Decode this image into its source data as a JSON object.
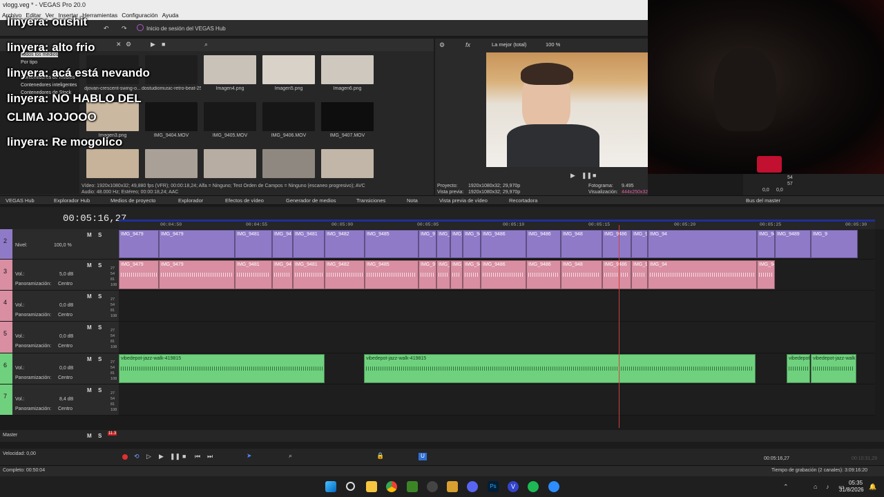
{
  "window": {
    "title": "vlogg.veg * - VEGAS Pro 20.0"
  },
  "menu": [
    "Archivo",
    "Editar",
    "Ver",
    "Insertar",
    "Herramientas",
    "Configuración",
    "Ayuda"
  ],
  "hub": {
    "label": "Inicio de sesión del VEGAS Hub"
  },
  "media": {
    "tree": [
      "Todos los medios",
      "Por tipo",
      "Contenedores de medios",
      "Contenedores inteligentes",
      "Contenedores de Stock"
    ],
    "items": [
      {
        "caption": "djovan-crescent-swing-o...",
        "color": "#1e1e1e"
      },
      {
        "caption": "dostudiomusic-retro-beat-255330.mp3",
        "color": "#1e1e1e"
      },
      {
        "caption": "Imagen4.png",
        "color": "#c9c2b8"
      },
      {
        "caption": "Imagen5.png",
        "color": "#d8d2c8"
      },
      {
        "caption": "Imagen6.png",
        "color": "#cfc8bf"
      },
      {
        "caption": "Imagen3.png",
        "color": "#cbb8a0"
      },
      {
        "caption": "IMG_9404.MOV",
        "color": "#141414"
      },
      {
        "caption": "IMG_9405.MOV",
        "color": "#181818"
      },
      {
        "caption": "IMG_9406.MOV",
        "color": "#161616"
      },
      {
        "caption": "IMG_9407.MOV",
        "color": "#0e0e0e"
      },
      {
        "caption": "",
        "color": "#c7b29a"
      },
      {
        "caption": "",
        "color": "#a9a198"
      },
      {
        "caption": "",
        "color": "#b7ada2"
      },
      {
        "caption": "",
        "color": "#8f8880"
      },
      {
        "caption": "",
        "color": "#c1b6a8"
      }
    ],
    "info1": "Vídeo: 1920x1080x32; 49,880 fps (VFR); 00:00:18,24; Alfa = Ninguno; Test Orden de Campos = Ninguno (escaneo progresivo); AVC",
    "info2": "Audio: 48.000 Hz; Estéreo; 00:00:18,24; AAC"
  },
  "preview": {
    "quality": "La mejor (total)",
    "zoom": "100 %",
    "proyecto_label": "Proyecto:",
    "proyecto": "1920x1080x32; 29,970p",
    "vista_label": "Vista previa:",
    "vista": "1920x1080x32; 29,970p",
    "fotograma_label": "Fotograma:",
    "fotograma": "9.495",
    "visual_label": "Visualización:",
    "visual": "444x250x32"
  },
  "bus": {
    "label": "Bus del master",
    "vals": [
      "54",
      "57",
      "0,0",
      "0,0"
    ]
  },
  "tabs": [
    "VEGAS Hub",
    "Explorador Hub",
    "Medios de proyecto",
    "Explorador",
    "Efectos de vídeo",
    "Generador de medios",
    "Transiciones",
    "Nota",
    "Vista previa de vídeo",
    "Recortadora",
    "Bus del master"
  ],
  "timeline": {
    "timecode": "00:05:16,27",
    "ruler": [
      "00:04:50",
      "00:04:55",
      "00:05:00",
      "00:05:05",
      "00:05:10",
      "00:05:15",
      "00:05:20",
      "00:05:25",
      "00:05:30"
    ],
    "tracks": [
      {
        "num": "2",
        "kind": "video",
        "labels": [
          "Nivel:",
          "100,0 %"
        ]
      },
      {
        "num": "3",
        "kind": "audio",
        "vol": "5,0 dB",
        "pan": "Centro"
      },
      {
        "num": "4",
        "kind": "audio",
        "vol": "0,0 dB",
        "pan": "Centro"
      },
      {
        "num": "5",
        "kind": "audio",
        "vol": "0,0 dB",
        "pan": "Centro"
      },
      {
        "num": "6",
        "kind": "audio",
        "vol": "0,0 dB",
        "pan": "Centro"
      },
      {
        "num": "7",
        "kind": "audio",
        "vol": "8,4 dB",
        "pan": "Centro"
      }
    ],
    "vol_label": "Vol.:",
    "pan_label": "Panoramización:",
    "meter": [
      "27",
      "54",
      "81",
      "108"
    ],
    "video_clips": [
      {
        "label": "IMG_9479"
      },
      {
        "label": "IMG_9479"
      },
      {
        "label": "IMG_9481"
      },
      {
        "label": "IMG_94"
      },
      {
        "label": "IMG_9481"
      },
      {
        "label": "IMG_9482"
      },
      {
        "label": "IMG_9485"
      },
      {
        "label": "IMG_9"
      },
      {
        "label": "IMG_9486"
      },
      {
        "label": "IMG_9"
      },
      {
        "label": "IMG_9486"
      },
      {
        "label": "IMG_9486"
      },
      {
        "label": "IMG_9486"
      },
      {
        "label": "IMG_948"
      },
      {
        "label": "IMG_9486"
      },
      {
        "label": "IMG_9486"
      },
      {
        "label": "IMG_94"
      },
      {
        "label": "IMG_9486"
      },
      {
        "label": "IMG_9489"
      },
      {
        "label": "IMG_9"
      }
    ],
    "music_clips": [
      {
        "label": "vibedepot-jazz-walk-419815"
      },
      {
        "label": "vibedepot-jazz-walk-419815"
      },
      {
        "label": "vibedepot"
      },
      {
        "label": "vibedepot-jazz-walk"
      }
    ]
  },
  "master": {
    "label": "Master",
    "peak": "11.3"
  },
  "speed": {
    "label": "Velocidad: 0,00"
  },
  "status": {
    "left": "Completo: 00:50:04",
    "record": "Tiempo de grabación (2 canales): 3:09:16:20",
    "tc": "00:05:16,27",
    "tc2": "00:10:31,29"
  },
  "clock": {
    "time": "05:35",
    "date": "31/8/2026"
  },
  "chat": [
    "linyera: oushit",
    "linyera: alto frio",
    "linyera: acá está nevando",
    "linyera: NO HABLO DEL",
    "CLIMA JOJOOO",
    "linyera: Re mogolico"
  ]
}
